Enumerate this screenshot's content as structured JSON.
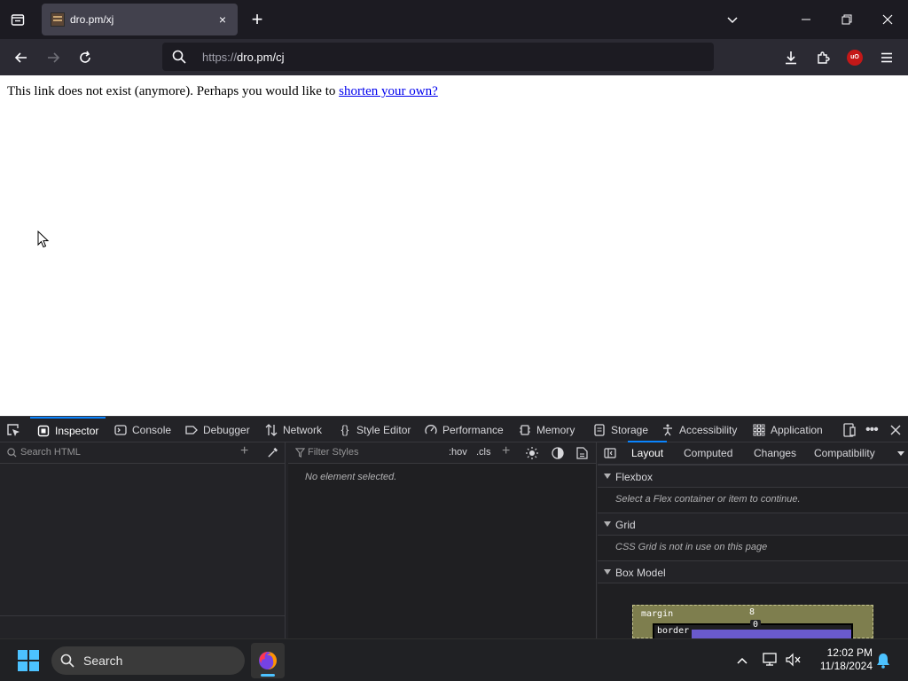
{
  "browser": {
    "tab": {
      "title": "dro.pm/xj",
      "close": "×"
    },
    "new_tab": "+",
    "url": {
      "scheme": "https://",
      "rest": "dro.pm/cj"
    },
    "ublock_badge": "uO"
  },
  "page": {
    "text": "This link does not exist (anymore). Perhaps you would like to ",
    "link": "shorten your own?"
  },
  "devtools": {
    "tools": [
      "Inspector",
      "Console",
      "Debugger",
      "Network",
      "Style Editor",
      "Performance",
      "Memory",
      "Storage",
      "Accessibility",
      "Application"
    ],
    "search_html_placeholder": "Search HTML",
    "filter_styles_placeholder": "Filter Styles",
    "hov": ":hov",
    "cls": ".cls",
    "no_element": "No element selected.",
    "sidebar_tabs": [
      "Layout",
      "Computed",
      "Changes",
      "Compatibility"
    ],
    "flexbox": {
      "label": "Flexbox",
      "note": "Select a Flex container or item to continue."
    },
    "grid": {
      "label": "Grid",
      "note": "CSS Grid is not in use on this page"
    },
    "boxmodel": {
      "label": "Box Model",
      "margin_label": "margin",
      "margin_value": "8",
      "border_label": "border",
      "border_value": "0"
    }
  },
  "taskbar": {
    "search_label": "Search",
    "time": "12:02 PM",
    "date": "11/18/2024"
  },
  "colors": {
    "accent": "#0a84ff",
    "link": "#0000ee",
    "windows_accent": "#4cc2ff"
  }
}
